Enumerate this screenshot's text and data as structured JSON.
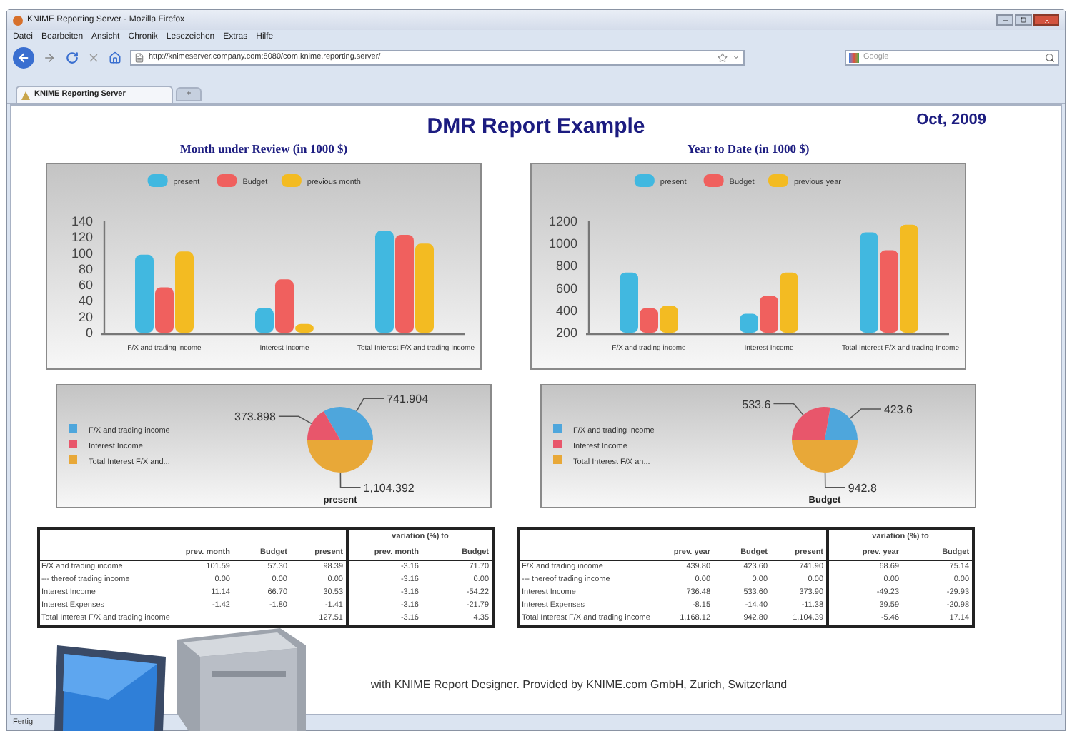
{
  "browser": {
    "title": "KNIME Reporting Server - Mozilla Firefox",
    "menu": [
      "Datei",
      "Bearbeiten",
      "Ansicht",
      "Chronik",
      "Lesezeichen",
      "Extras",
      "Hilfe"
    ],
    "url": "http://knimeserver.company.com:8080/com.knime.reporting.server/",
    "search": {
      "placeholder": "Google"
    },
    "tabs": [
      {
        "label": "KNIME Reporting Server",
        "selected": true
      }
    ],
    "new_tab": "+",
    "status": "Fertig"
  },
  "report": {
    "title": "DMR Report Example",
    "date": "Oct, 2009",
    "sections": [
      {
        "heading": "Month under Review (in 1000 $)",
        "chart_data": {
          "type": "bar",
          "categories": [
            "F/X and trading income",
            "Interest Income",
            "Total Interest F/X and trading Income"
          ],
          "series": [
            {
              "name": "present",
              "color": "#41b8e0",
              "values": [
                98,
                31,
                128
              ]
            },
            {
              "name": "Budget",
              "color": "#f0605e",
              "values": [
                57,
                67,
                123
              ]
            },
            {
              "name": "previous month",
              "color": "#f3bb22",
              "values": [
                102,
                11,
                112
              ]
            }
          ],
          "ylim": [
            0,
            140
          ],
          "yticks": [
            0,
            20,
            40,
            60,
            80,
            100,
            120,
            140
          ],
          "legend": true
        },
        "pie": {
          "chart_data": {
            "type": "pie",
            "title": "present",
            "categories": [
              "F/X and trading income",
              "Interest Income",
              "Total Interest F/X and..."
            ],
            "values": [
              741.904,
              373.898,
              1104.392
            ],
            "value_labels": [
              "741.904",
              "373.898",
              "1,104.392"
            ],
            "legend": true
          }
        }
      },
      {
        "heading": "Year to Date (in 1000 $)",
        "chart_data": {
          "type": "bar",
          "categories": [
            "F/X and trading income",
            "Interest Income",
            "Total Interest F/X and trading Income"
          ],
          "series": [
            {
              "name": "present",
              "color": "#41b8e0",
              "values": [
                740,
                370,
                1100
              ]
            },
            {
              "name": "Budget",
              "color": "#f0605e",
              "values": [
                420,
                530,
                940
              ]
            },
            {
              "name": "previous year",
              "color": "#f3bb22",
              "values": [
                440,
                740,
                1170
              ]
            }
          ],
          "ylim": [
            200,
            1200
          ],
          "yticks": [
            200,
            400,
            600,
            800,
            1000,
            1200
          ],
          "legend": true
        },
        "pie": {
          "chart_data": {
            "type": "pie",
            "title": "Budget",
            "categories": [
              "F/X and trading income",
              "Interest Income",
              "Total Interest F/X an..."
            ],
            "values": [
              423.6,
              533.6,
              942.8
            ],
            "value_labels": [
              "423.6",
              "533.6",
              "942.8"
            ],
            "legend": true
          }
        }
      }
    ],
    "tables": [
      {
        "group_header": "variation (%) to",
        "columns": [
          "prev. month",
          "Budget",
          "present",
          "prev. month",
          "Budget"
        ],
        "rows": [
          {
            "label": "F/X and trading income",
            "cells": [
              "101.59",
              "57.30",
              "98.39",
              "-3.16",
              "71.70"
            ]
          },
          {
            "label": "--- thereof trading income",
            "cells": [
              "0.00",
              "0.00",
              "0.00",
              "-3.16",
              "0.00"
            ]
          },
          {
            "label": "Interest Income",
            "cells": [
              "11.14",
              "66.70",
              "30.53",
              "-3.16",
              "-54.22"
            ]
          },
          {
            "label": "Interest Expenses",
            "cells": [
              "-1.42",
              "-1.80",
              "-1.41",
              "-3.16",
              "-21.79"
            ]
          },
          {
            "label": "Total Interest F/X and trading income",
            "cells": [
              null,
              null,
              "127.51",
              "-3.16",
              "4.35"
            ]
          }
        ]
      },
      {
        "group_header": "variation (%) to",
        "columns": [
          "prev. year",
          "Budget",
          "present",
          "prev. year",
          "Budget"
        ],
        "rows": [
          {
            "label": "F/X and trading income",
            "cells": [
              "439.80",
              "423.60",
              "741.90",
              "68.69",
              "75.14"
            ]
          },
          {
            "label": "--- thereof trading income",
            "cells": [
              "0.00",
              "0.00",
              "0.00",
              "0.00",
              "0.00"
            ]
          },
          {
            "label": "Interest Income",
            "cells": [
              "736.48",
              "533.60",
              "373.90",
              "-49.23",
              "-29.93"
            ]
          },
          {
            "label": "Interest Expenses",
            "cells": [
              "-8.15",
              "-14.40",
              "-11.38",
              "39.59",
              "-20.98"
            ]
          },
          {
            "label": "Total Interest F/X and trading income",
            "cells": [
              "1,168.12",
              "942.80",
              "1,104.39",
              "-5.46",
              "17.14"
            ]
          }
        ]
      }
    ],
    "footer": "with KNIME Report Designer. Provided by KNIME.com GmbH, Zurich, Switzerland"
  }
}
